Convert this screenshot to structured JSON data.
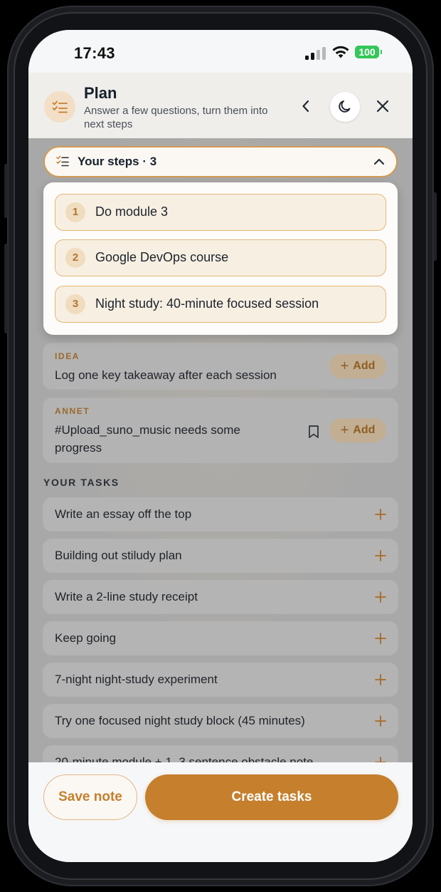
{
  "status_bar": {
    "time": "17:43",
    "battery": "100",
    "battery_color": "#34c759"
  },
  "header": {
    "icon": "checklist-icon",
    "title": "Plan",
    "subtitle": "Answer a few questions, turn them into next steps",
    "back_icon": "chevron-left-icon",
    "theme_icon": "moon-icon",
    "close_icon": "close-icon"
  },
  "steps": {
    "toggle_label": "Your steps · 3",
    "items": [
      {
        "number": "1",
        "label": "Do module 3"
      },
      {
        "number": "2",
        "label": "Google DevOps course"
      },
      {
        "number": "3",
        "label": "Night study: 40-minute focused session"
      }
    ]
  },
  "suggestions": [
    {
      "kicker": "IDEA",
      "text": "Log one key takeaway after each session",
      "add_label": "Add",
      "bookmark": false
    },
    {
      "kicker": "ANNET",
      "text": "#Upload_suno_music needs some progress",
      "add_label": "Add",
      "bookmark": true
    }
  ],
  "tasks": {
    "section_label": "YOUR TASKS",
    "items": [
      "Write an essay off the top",
      "Building out stiludy plan",
      "Write a 2-line study receipt",
      "Keep going",
      "7-night night-study experiment",
      "Try one focused night study block (45 minutes)",
      "20-minute module + 1–3 sentence obstacle note"
    ]
  },
  "actions": {
    "save_label": "Save note",
    "create_label": "Create tasks"
  },
  "colors": {
    "accent": "#c57f2d",
    "accent_soft": "#f0dcbf",
    "text_dark": "#17202c"
  }
}
